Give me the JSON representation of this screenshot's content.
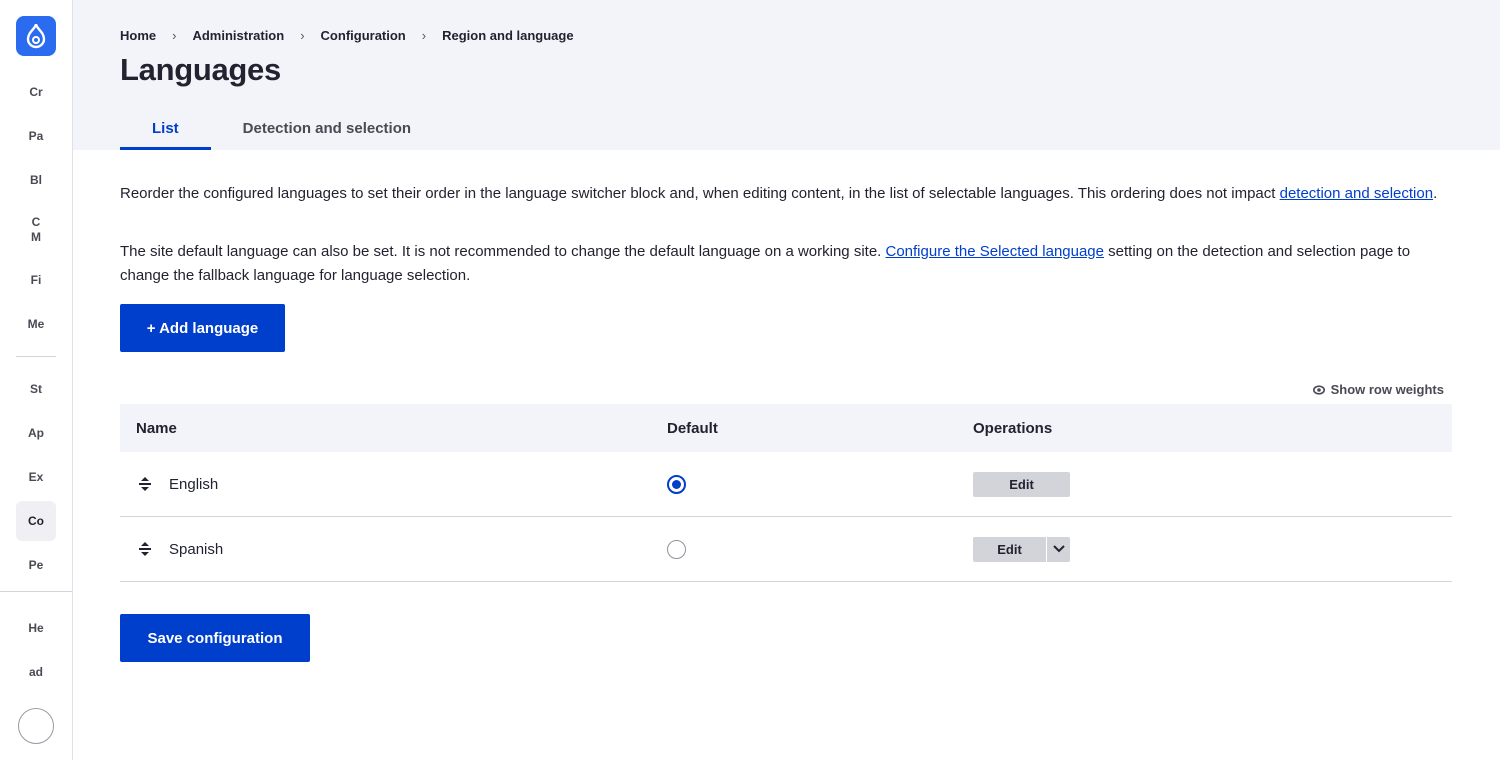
{
  "sidebar": {
    "items": [
      {
        "label": "Cr"
      },
      {
        "label": "Pa"
      },
      {
        "label": "Bl"
      },
      {
        "label": "C\nM"
      },
      {
        "label": "Fi"
      },
      {
        "label": "Me"
      },
      {
        "label": "St"
      },
      {
        "label": "Ap"
      },
      {
        "label": "Ex"
      },
      {
        "label": "Co"
      },
      {
        "label": "Pe"
      },
      {
        "label": "He"
      },
      {
        "label": "ad"
      }
    ]
  },
  "breadcrumb": [
    "Home",
    "Administration",
    "Configuration",
    "Region and language"
  ],
  "breadcrumb_separator": "›",
  "page_title": "Languages",
  "tabs": [
    {
      "label": "List",
      "active": true
    },
    {
      "label": "Detection and selection",
      "active": false
    }
  ],
  "description": {
    "p1_text": "Reorder the configured languages to set their order in the language switcher block and, when editing content, in the list of selectable languages. This ordering does not impact ",
    "p1_link": "detection and selection",
    "p1_end": ".",
    "p2_text": "The site default language can also be set. It is not recommended to change the default language on a working site. ",
    "p2_link": "Configure the Selected language",
    "p2_end": " setting on the detection and selection page to change the fallback language for language selection."
  },
  "add_button": "+ Add language",
  "show_row_weights": "Show row weights",
  "table": {
    "headers": {
      "name": "Name",
      "default": "Default",
      "operations": "Operations"
    },
    "rows": [
      {
        "name": "English",
        "default": true,
        "edit": "Edit"
      },
      {
        "name": "Spanish",
        "default": false,
        "edit": "Edit"
      }
    ]
  },
  "save_button": "Save configuration",
  "colors": {
    "primary": "#003ecc",
    "logo": "#2b6bf0",
    "header_bg": "#f3f4f9"
  }
}
